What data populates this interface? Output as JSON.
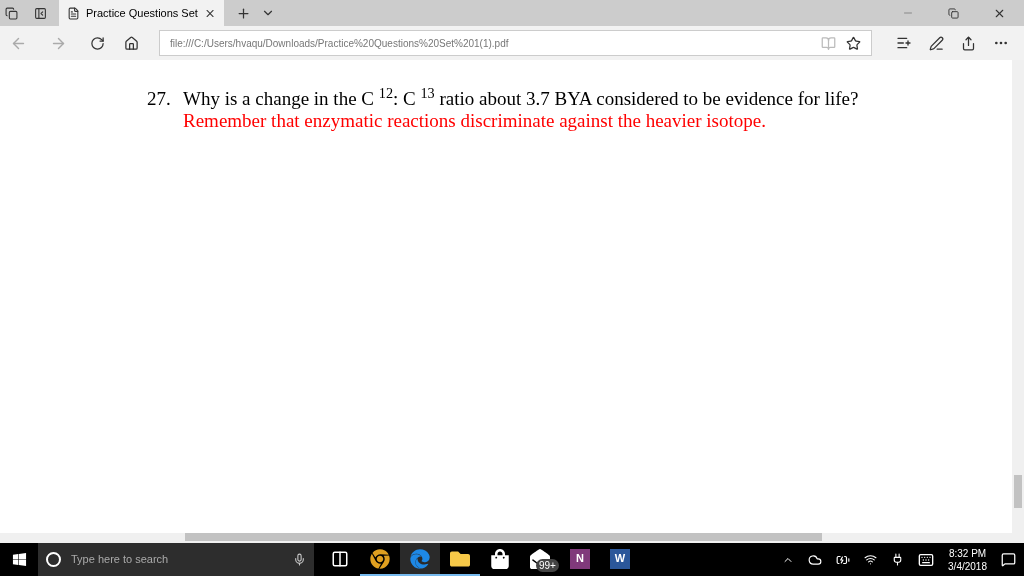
{
  "tab": {
    "title": "Practice Questions Set",
    "selected": true
  },
  "address_bar": {
    "value": "file:///C:/Users/hvaqu/Downloads/Practice%20Questions%20Set%201(1).pdf"
  },
  "document": {
    "number": "27.",
    "question": "Why is a change in the C $^{12}$: C $^{13}$ ratio about 3.7 BYA considered to be evidence for life?",
    "answer": "Remember that enzymatic reactions discriminate against the heavier isotope."
  },
  "taskbar": {
    "search_placeholder": "Type here to search",
    "apps": [
      {
        "kind": "taskview",
        "running": false,
        "selected": false
      },
      {
        "kind": "chrome",
        "running": true,
        "selected": false
      },
      {
        "kind": "edge",
        "running": true,
        "selected": true
      },
      {
        "kind": "explorer",
        "running": true,
        "selected": false
      },
      {
        "kind": "store",
        "running": false,
        "selected": false
      },
      {
        "kind": "mail",
        "badge": "99+",
        "running": false,
        "selected": false
      },
      {
        "kind": "onenote",
        "letter": "N",
        "running": false,
        "selected": false
      },
      {
        "kind": "word",
        "letter": "W",
        "running": false,
        "selected": false
      }
    ],
    "time": "8:32 PM",
    "date": "3/4/2018"
  }
}
